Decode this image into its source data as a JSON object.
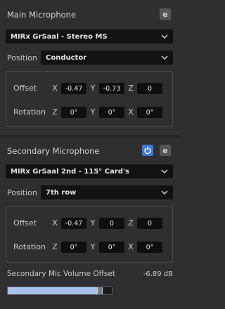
{
  "main_mic": {
    "title": "Main Microphone",
    "e_label": "e",
    "preset": "MIRx GrSaal - Stereo MS",
    "position_label": "Position",
    "position_value": "Conductor",
    "offset_label": "Offset",
    "offset": {
      "x_label": "X",
      "x": "-0.47",
      "y_label": "Y",
      "y": "-0.73",
      "z_label": "Z",
      "z": "0"
    },
    "rotation_label": "Rotation",
    "rotation": {
      "z_label": "Z",
      "z": "0°",
      "y_label": "Y",
      "y": "0°",
      "x_label": "X",
      "x": "0°"
    }
  },
  "secondary_mic": {
    "title": "Secondary Microphone",
    "e_label": "e",
    "power_on": true,
    "preset": "MIRx GrSaal 2nd - 115° Card's",
    "position_label": "Position",
    "position_value": "7th row",
    "offset_label": "Offset",
    "offset": {
      "x_label": "X",
      "x": "-0.47",
      "y_label": "Y",
      "y": "0",
      "z_label": "Z",
      "z": "0"
    },
    "rotation_label": "Rotation",
    "rotation": {
      "z_label": "Z",
      "z": "0°",
      "y_label": "Y",
      "y": "0°",
      "x_label": "X",
      "x": "0°"
    },
    "volume_offset_label": "Secondary Mic Volume Offset",
    "volume_offset_value": "-6.89 dB",
    "volume_slider_fraction": 0.91
  },
  "colors": {
    "accent": "#3d77d8",
    "slider_fill": "#a9c2ec",
    "panel_bg": "#2f2f31",
    "field_bg": "#121212"
  }
}
